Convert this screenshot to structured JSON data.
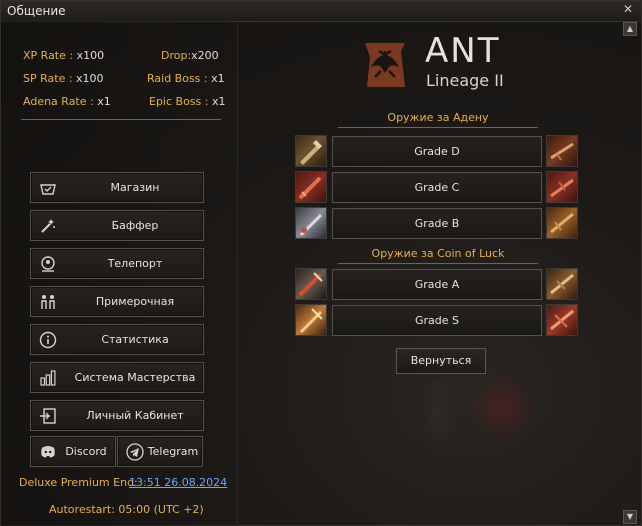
{
  "window": {
    "title": "Общение",
    "close": "✕"
  },
  "rates": {
    "xp": {
      "key": "XP Rate :",
      "value": "x100"
    },
    "drop": {
      "key": "Drop:",
      "value": "x200"
    },
    "sp": {
      "key": "SP Rate :",
      "value": "x100"
    },
    "raid": {
      "key": "Raid Boss :",
      "value": "x1"
    },
    "adena": {
      "key": "Adena Rate :",
      "value": "x1"
    },
    "epic": {
      "key": "Epic Boss :",
      "value": "x1"
    }
  },
  "menu": {
    "shop": "Магазин",
    "buffer": "Баффер",
    "teleport": "Телепорт",
    "fitting": "Примерочная",
    "stats": "Статистика",
    "mastery": "Система Мастерства",
    "cabinet": "Личный Кабинет",
    "discord": "Discord",
    "telegram": "Telegram"
  },
  "premium": {
    "label": "Deluxe Premium End:",
    "value": "13:51 26.08.2024"
  },
  "autorestart": "Autorestart: 05:00 (UTC +2)",
  "logo": {
    "name": "ANT",
    "sub": "Lineage II"
  },
  "weapons": {
    "adena_title": "Оружие за Адену",
    "coin_title": "Оружие за Coin of Luck",
    "grade_d": "Grade D",
    "grade_c": "Grade C",
    "grade_b": "Grade B",
    "grade_a": "Grade A",
    "grade_s": "Grade S"
  },
  "back": "Вернуться",
  "colors": {
    "accent": "#e5b04f",
    "link": "#6aa5ff",
    "text": "#e8e4dc"
  }
}
